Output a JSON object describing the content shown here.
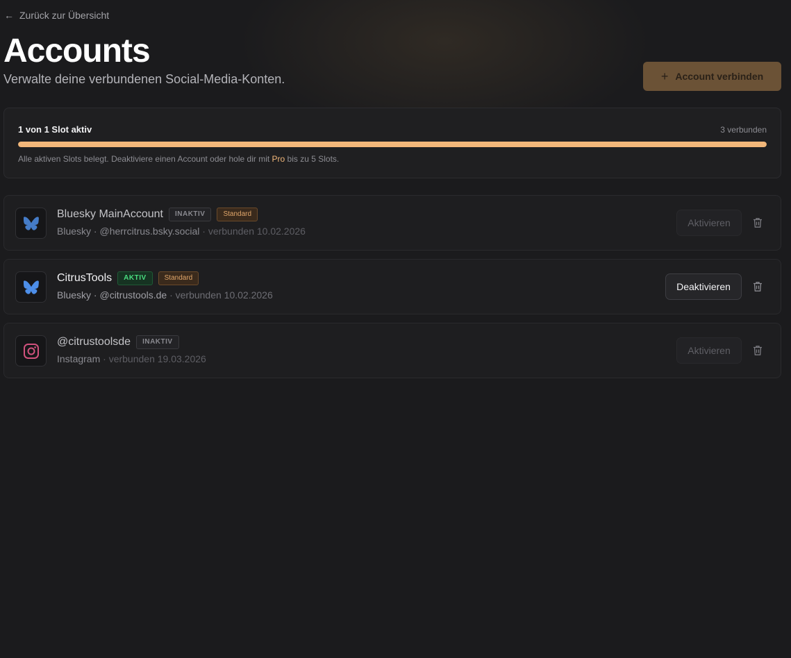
{
  "nav": {
    "back_arrow": "←",
    "back_label": "Zurück zur Übersicht"
  },
  "header": {
    "title": "Accounts",
    "subtitle": "Verwalte deine verbundenen Social-Media-Konten.",
    "connect_plus": "+",
    "connect_label": "Account verbinden"
  },
  "slots": {
    "title": "1 von 1 Slot aktiv",
    "connected_count": "3 verbunden",
    "progress_fraction": 1.0,
    "note_before": "Alle aktiven Slots belegt. Deaktiviere einen Account oder hole dir mit ",
    "note_pro": "Pro",
    "note_after": " bis zu 5 Slots.",
    "accent_color": "#f2b77a"
  },
  "accounts": [
    {
      "name": "Bluesky MainAccount",
      "status": "INAKTIV",
      "default_badge": "Standard",
      "platform": "Bluesky",
      "handle": "@herrcitrus.bsky.social",
      "connected": "· verbunden 10.02.2026",
      "action_label": "Aktivieren",
      "icon": "bluesky-butterfly-icon"
    },
    {
      "name": "CitrusTools",
      "status": "AKTIV",
      "default_badge": "Standard",
      "platform": "Bluesky",
      "handle": "@citrustools.de",
      "connected": "· verbunden 10.02.2026",
      "action_label": "Deaktivieren",
      "icon": "bluesky-butterfly-icon"
    },
    {
      "name": "@citrustoolsde",
      "status": "INAKTIV",
      "platform": "Instagram",
      "connected": "· verbunden 19.03.2026",
      "action_label": "Aktivieren",
      "icon": "instagram-icon"
    }
  ],
  "colors": {
    "bluesky": "#4d8ee8",
    "instagram": "#d2527e",
    "active_green": "#4ade80",
    "standard_orange": "#e0a66a"
  }
}
